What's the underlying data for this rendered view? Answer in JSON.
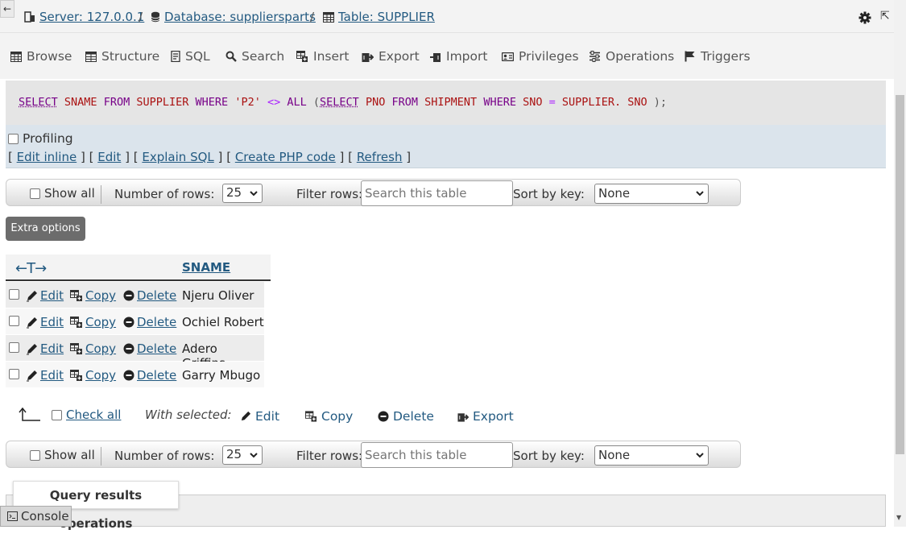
{
  "breadcrumb": {
    "server": "Server: 127.0.0.1",
    "database": "Database: suppliersparts",
    "table": "Table: SUPPLIER",
    "separator": "/"
  },
  "tabs": [
    {
      "label": "Browse",
      "icon": "browse-icon"
    },
    {
      "label": "Structure",
      "icon": "structure-icon"
    },
    {
      "label": "SQL",
      "icon": "sql-icon"
    },
    {
      "label": "Search",
      "icon": "search-icon"
    },
    {
      "label": "Insert",
      "icon": "insert-icon"
    },
    {
      "label": "Export",
      "icon": "export-icon"
    },
    {
      "label": "Import",
      "icon": "import-icon"
    },
    {
      "label": "Privileges",
      "icon": "privileges-icon"
    },
    {
      "label": "Operations",
      "icon": "operations-icon"
    },
    {
      "label": "Triggers",
      "icon": "triggers-icon"
    }
  ],
  "sql": {
    "t1": "SELECT",
    "t2": "SNAME",
    "t3": "FROM",
    "t4": "SUPPLIER",
    "t5": "WHERE",
    "t6": "'P2'",
    "t7": "<>",
    "t8": "ALL",
    "t9": "(",
    "t10": "SELECT",
    "t11": "PNO",
    "t12": "FROM",
    "t13": "SHIPMENT",
    "t14": "WHERE",
    "t15": "SNO",
    "t16": "=",
    "t17": "SUPPLIER.",
    "t18": "SNO",
    "t19": ");"
  },
  "profiling": {
    "label": "Profiling",
    "links": {
      "edit_inline": "Edit inline",
      "edit": "Edit",
      "explain": "Explain SQL",
      "php": "Create PHP code",
      "refresh": "Refresh"
    },
    "bracket_open": "[",
    "bracket_close": "]"
  },
  "nav": {
    "show_all": "Show all",
    "rows_label": "Number of rows:",
    "rows_value": "25",
    "filter_label": "Filter rows:",
    "filter_placeholder": "Search this table",
    "sort_label": "Sort by key:",
    "sort_value": "None"
  },
  "extra_options": "Extra options",
  "table": {
    "arrows": "←T→",
    "column": "SNAME",
    "actions": {
      "edit": "Edit",
      "copy": "Copy",
      "delete": "Delete"
    },
    "rows": [
      "Njeru Oliver",
      "Ochiel Robert",
      "Adero Griffins",
      "Garry Mbugo"
    ]
  },
  "with_selected": {
    "check_all": "Check all",
    "label": "With selected:",
    "edit": "Edit",
    "copy": "Copy",
    "delete": "Delete",
    "export": "Export"
  },
  "query_results_operations": "Query results operations",
  "console": "Console",
  "colors": {
    "link": "#235a81",
    "sql_keyword": "#770088",
    "sql_identifier": "#aa1111",
    "sql_operator": "#aa22ff"
  }
}
